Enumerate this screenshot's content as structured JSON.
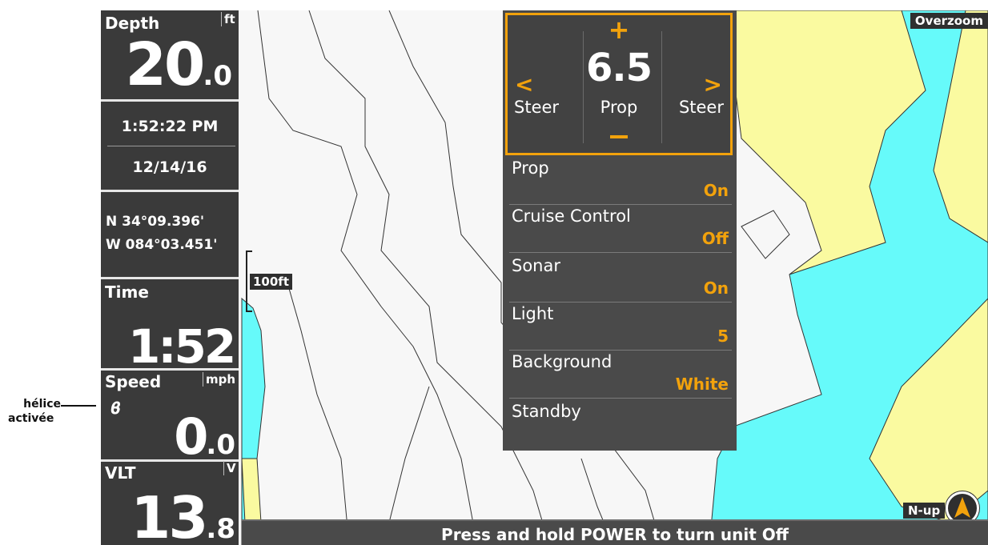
{
  "callout": {
    "line1": "hélice",
    "line2": "activée"
  },
  "sidebar": {
    "depth": {
      "label": "Depth",
      "unit": "ft",
      "int": "20",
      "dec": ".0"
    },
    "clock": "1:52:22 PM",
    "date": "12/14/16",
    "lat": "N 34°09.396'",
    "lon": "W 084°03.451'",
    "time": {
      "label": "Time",
      "value": "1:52"
    },
    "speed": {
      "label": "Speed",
      "unit": "mph",
      "int": "0",
      "dec": ".0",
      "icon": "propeller-icon"
    },
    "vlt": {
      "label": "VLT",
      "unit": "V",
      "int": "13",
      "dec": ".8"
    }
  },
  "map": {
    "scale": "100ft",
    "overzoom": "Overzoom",
    "orientation": "N-up"
  },
  "trolling": {
    "plus": "+",
    "speed": "6.5",
    "center_label": "Prop",
    "left_arrow": "<",
    "right_arrow": ">",
    "left_label": "Steer",
    "right_label": "Steer"
  },
  "menu": [
    {
      "name": "Prop",
      "value": "On"
    },
    {
      "name": "Cruise Control",
      "value": "Off"
    },
    {
      "name": "Sonar",
      "value": "On"
    },
    {
      "name": "Light",
      "value": "5"
    },
    {
      "name": "Background",
      "value": "White"
    },
    {
      "name": "Standby",
      "value": ""
    }
  ],
  "status": "Press and hold POWER to turn unit Off",
  "colors": {
    "accent": "#f2a20c",
    "water": "#66fafa",
    "land": "#fafaa0",
    "panel": "#4a4a4a"
  }
}
